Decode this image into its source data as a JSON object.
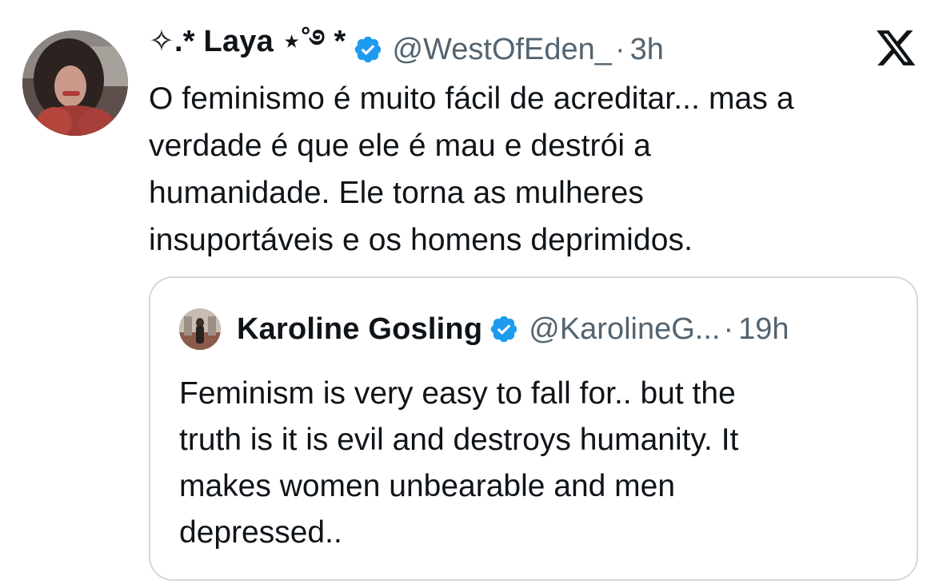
{
  "tweet": {
    "display_name": "✧.* Laya ⋆˚࿔ *",
    "handle": "@WestOfEden_",
    "separator": "·",
    "time": "3h",
    "verified_icon": "verified-badge-icon",
    "text_lines": [
      "O feminismo é muito fácil de acreditar... mas a",
      "verdade é que ele é mau e destrói a",
      "humanidade. Ele torna as mulheres",
      "insuportáveis e os homens deprimidos."
    ]
  },
  "quoted_tweet": {
    "display_name": "Karoline Gosling",
    "handle": "@KarolineG...",
    "separator": "·",
    "time": "19h",
    "verified_icon": "verified-badge-icon",
    "text_lines": [
      "Feminism is very easy to fall for.. but the",
      "truth is it is evil and destroys humanity. It",
      "makes women unbearable and men",
      "depressed.."
    ]
  },
  "brand": {
    "logo_icon": "x-logo-icon"
  },
  "colors": {
    "text": "#0f1419",
    "secondary_text": "#536471",
    "verified_blue": "#1d9bf0",
    "border": "#cfd9de"
  }
}
